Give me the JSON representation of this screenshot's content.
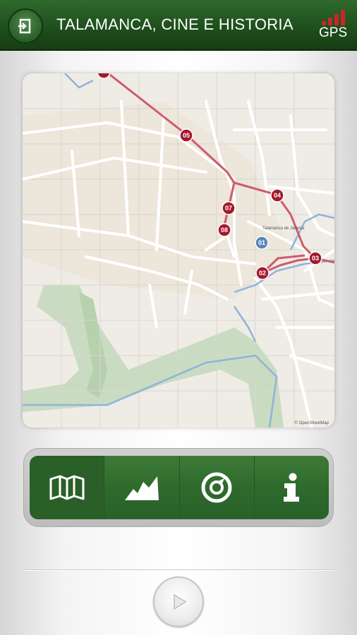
{
  "header": {
    "title": "TALAMANCA, CINE E HISTORIA",
    "gps_label": "GPS",
    "back_icon": "exit-icon",
    "signal_icon": "signal-bars-icon",
    "bar_color": "#1f4f1d",
    "gps_bar_color": "#c62828"
  },
  "map": {
    "town_label": "Talamanca de Jarama",
    "attribution": "© OpenStreetMap",
    "route_color": "#d05a6e",
    "marker_color": "#a3192b",
    "current_marker_color": "#5b86b8",
    "markers": [
      {
        "label": "05"
      },
      {
        "label": "04"
      },
      {
        "label": "07"
      },
      {
        "label": "08"
      },
      {
        "label": "01"
      },
      {
        "label": "02"
      },
      {
        "label": "03"
      }
    ]
  },
  "tabs": [
    {
      "name": "map",
      "icon": "map-icon",
      "active": true
    },
    {
      "name": "elevation",
      "icon": "mountain-chart-icon",
      "active": false
    },
    {
      "name": "compass",
      "icon": "target-icon",
      "active": false
    },
    {
      "name": "info",
      "icon": "info-icon",
      "active": false
    }
  ],
  "play": {
    "icon": "play-icon"
  }
}
